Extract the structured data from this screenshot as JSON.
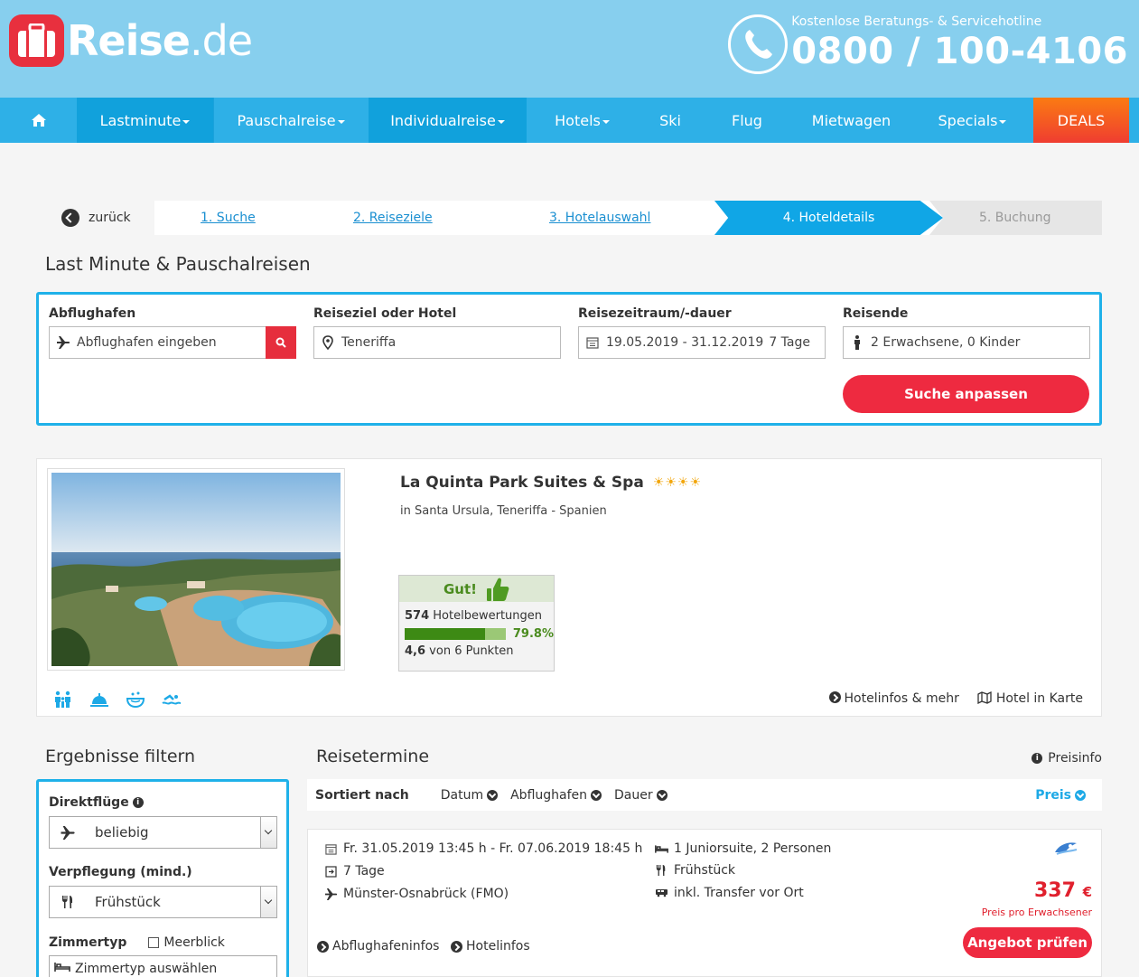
{
  "brand": {
    "logo_bold": "Reise",
    "logo_light": ".de",
    "hotline_sub": "Kostenlose Beratungs- & Servicehotline",
    "hotline_number": "0800 / 100-4106",
    "colors": {
      "header": "#87cfee",
      "nav": "#2eb0e7",
      "accent": "#ee2a40",
      "highlight": "#1fb1e9"
    }
  },
  "nav": {
    "items": [
      {
        "label": "Lastminute",
        "dropdown": true
      },
      {
        "label": "Pauschalreise",
        "dropdown": true
      },
      {
        "label": "Individualreise",
        "dropdown": true
      },
      {
        "label": "Hotels",
        "dropdown": true
      },
      {
        "label": "Ski",
        "dropdown": false
      },
      {
        "label": "Flug",
        "dropdown": false
      },
      {
        "label": "Mietwagen",
        "dropdown": false
      },
      {
        "label": "Specials",
        "dropdown": true
      }
    ],
    "deals": "DEALS",
    "home_icon": "home-icon"
  },
  "steps": {
    "back": "zurück",
    "s1": "1. Suche",
    "s2": "2. Reiseziele",
    "s3": "3. Hotelauswahl",
    "s4": "4. Hoteldetails",
    "s5": "5. Buchung"
  },
  "search": {
    "title": "Last Minute & Pauschalreisen",
    "departure_label": "Abflughafen",
    "departure_placeholder": "Abflughafen eingeben",
    "destination_label": "Reiseziel oder Hotel",
    "destination_value": "Teneriffa",
    "period_label": "Reisezeitraum/-dauer",
    "period_value": "19.05.2019 - 31.12.2019",
    "period_days": "7 Tage",
    "travelers_label": "Reisende",
    "travelers_value": "2 Erwachsene, 0 Kinder",
    "submit": "Suche anpassen"
  },
  "hotel": {
    "name": "La Quinta Park Suites & Spa",
    "stars": 4,
    "location": "in Santa Ursula, Teneriffa - Spanien",
    "rating_word": "Gut!",
    "reviews_count": "574",
    "reviews_label": "Hotelbewertungen",
    "recommend_pct": "79.8%",
    "recommend_fraction": 0.798,
    "score": "4,6",
    "score_suffix": "von 6 Punkten",
    "link_info": "Hotelinfos & mehr",
    "link_map": "Hotel in Karte"
  },
  "filter": {
    "title": "Ergebnisse filtern",
    "direct_label": "Direktflüge",
    "direct_value": "beliebig",
    "board_label": "Verpflegung (mind.)",
    "board_value": "Frühstück",
    "room_label": "Zimmertyp",
    "seaview_label": "Meerblick",
    "room_placeholder": "Zimmertyp auswählen"
  },
  "results": {
    "title": "Reisetermine",
    "preisinfo": "Preisinfo",
    "sorted_by": "Sortiert nach",
    "sort_date": "Datum",
    "sort_airport": "Abflughafen",
    "sort_duration": "Dauer",
    "sort_price": "Preis",
    "offer": {
      "dates": "Fr. 31.05.2019 13:45 h - Fr. 07.06.2019 18:45 h",
      "duration": "7 Tage",
      "airport": "Münster-Osnabrück (FMO)",
      "room": "1 Juniorsuite, 2 Personen",
      "board": "Frühstück",
      "transfer": "inkl. Transfer vor Ort",
      "price": "337",
      "currency": "€",
      "price_note": "Preis pro Erwachsener",
      "check": "Angebot prüfen",
      "link_airport": "Abflughafeninfos",
      "link_hotel": "Hotelinfos"
    }
  }
}
